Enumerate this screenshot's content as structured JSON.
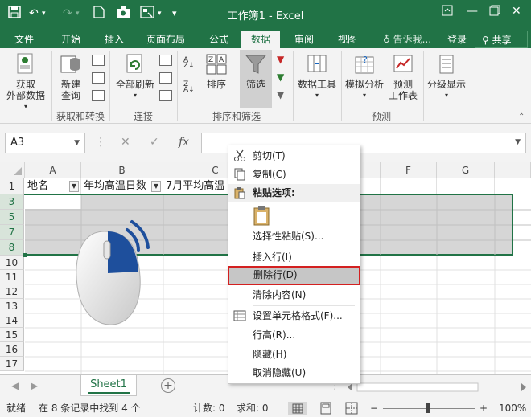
{
  "titlebar": {
    "title": "工作簿1 - Excel",
    "icons": [
      "save-icon",
      "undo-icon",
      "redo-icon",
      "new-file-icon",
      "camera-icon",
      "form-icon",
      "customize-qat-icon",
      "ribbon-display-icon",
      "minimize-icon",
      "restore-icon",
      "close-icon"
    ]
  },
  "tabs": {
    "items": [
      "文件",
      "开始",
      "插入",
      "页面布局",
      "公式",
      "数据",
      "审阅",
      "视图"
    ],
    "active": "数据",
    "tell_me": "告诉我...",
    "login": "登录",
    "share": "共享"
  },
  "ribbon": {
    "get_data": "获取\n外部数据",
    "new_query": "新建\n查询",
    "group_get_transform": "获取和转换",
    "refresh_all": "全部刷新",
    "group_connections": "连接",
    "sort": "排序",
    "filter": "筛选",
    "group_sort_filter": "排序和筛选",
    "data_tools": "数据工具",
    "what_if": "模拟分析",
    "forecast_sheet": "预测\n工作表",
    "group_forecast": "预测",
    "outline": "分级显示"
  },
  "formula_bar": {
    "name_box": "A3",
    "cancel": "✕",
    "enter": "✓",
    "fx": "fx",
    "value": ""
  },
  "grid": {
    "columns": [
      "A",
      "B",
      "C",
      "D",
      "E",
      "F",
      "G"
    ],
    "rows": [
      "1",
      "3",
      "5",
      "7",
      "8",
      "10",
      "11",
      "12",
      "13",
      "14",
      "15",
      "16",
      "17"
    ],
    "selected_rows": [
      "3",
      "5",
      "7",
      "8"
    ],
    "header_cells": {
      "A1": "地名",
      "B1": "年均高温日数",
      "C1": "7月平均高温"
    }
  },
  "context_menu": {
    "items": [
      {
        "label": "剪切(T)",
        "icon": "scissors-icon"
      },
      {
        "label": "复制(C)",
        "icon": "copy-icon"
      },
      {
        "label": "粘贴选项:",
        "icon": "paste-icon"
      },
      {
        "label": "",
        "icon": "paste-clipboard-icon"
      },
      {
        "label": "选择性粘贴(S)...",
        "icon": ""
      },
      {
        "label": "插入行(I)",
        "icon": ""
      },
      {
        "label": "删除行(D)",
        "icon": ""
      },
      {
        "label": "清除内容(N)",
        "icon": ""
      },
      {
        "label": "设置单元格格式(F)...",
        "icon": "format-cells-icon"
      },
      {
        "label": "行高(R)...",
        "icon": ""
      },
      {
        "label": "隐藏(H)",
        "icon": ""
      },
      {
        "label": "取消隐藏(U)",
        "icon": ""
      }
    ],
    "highlighted": "删除行(D)",
    "highlight_color": "#d32020"
  },
  "sheetbar": {
    "sheet": "Sheet1",
    "add": "+"
  },
  "status": {
    "ready": "就绪",
    "found": "在 8 条记录中找到 4 个",
    "count": "计数: 0",
    "sum": "求和: 0",
    "zoom": "100%"
  },
  "colors": {
    "brand": "#217346",
    "selection": "#d6d6d6"
  }
}
